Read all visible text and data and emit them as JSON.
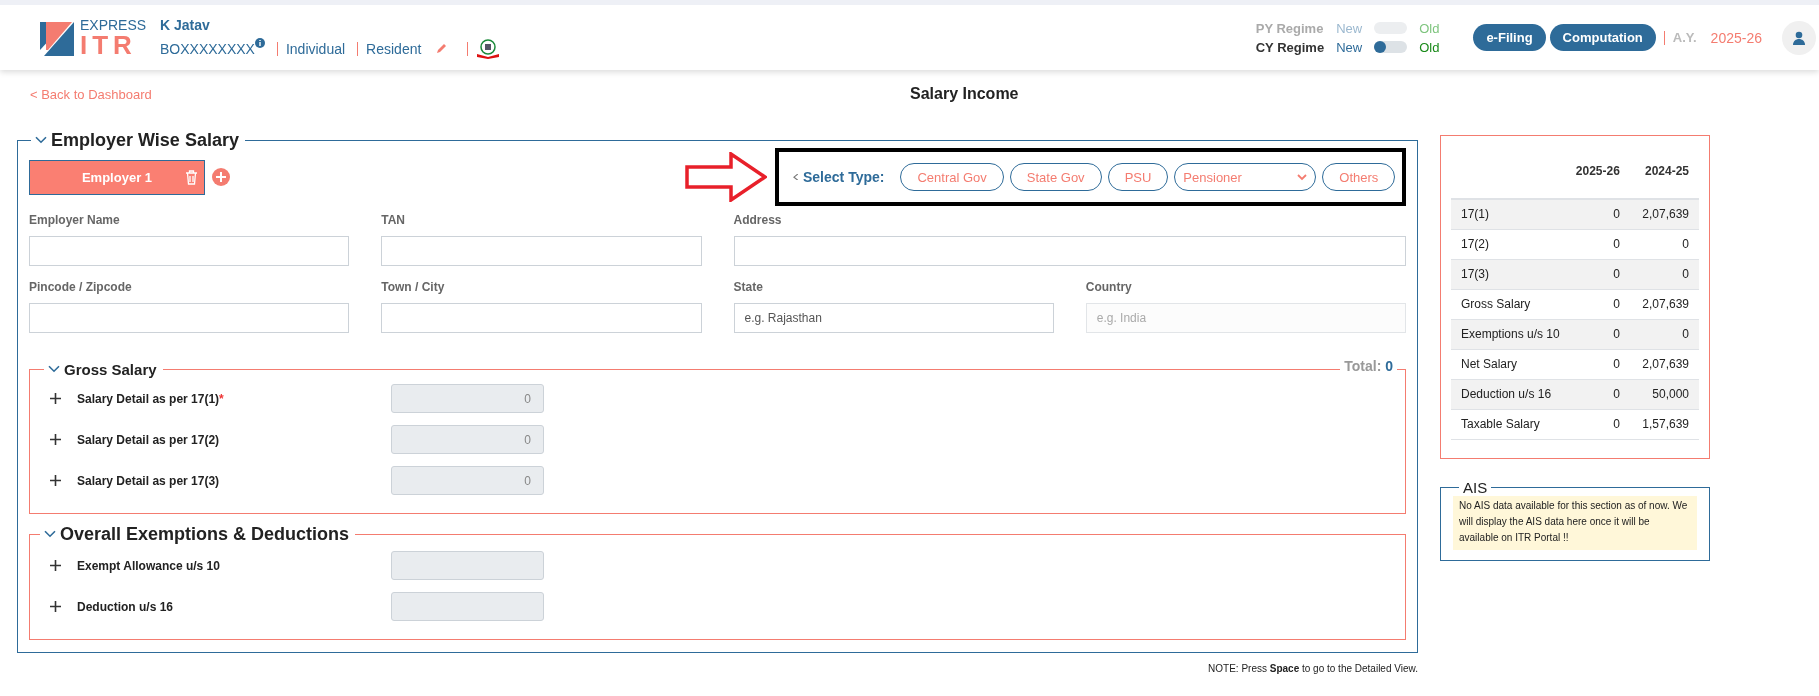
{
  "header": {
    "logo": {
      "top": "EXPRESS",
      "bottom": "ITR"
    },
    "user_name": "K Jatav",
    "pan": "BOXXXXXXXX",
    "status": [
      "Individual",
      "Resident"
    ],
    "regimes": [
      {
        "label": "PY Regime",
        "new_label": "New",
        "old_label": "Old",
        "disabled": true
      },
      {
        "label": "CY Regime",
        "new_label": "New",
        "old_label": "Old",
        "disabled": false,
        "old": false
      }
    ],
    "buttons": [
      "e-Filing",
      "Computation"
    ],
    "ay_label": "A.Y.",
    "ay_value": "2025-26"
  },
  "back_link": "< Back to Dashboard",
  "page_title": "Salary Income",
  "employer_section": {
    "title": "Employer Wise Salary",
    "employers": [
      {
        "label": "Employer 1",
        "selected": true
      }
    ],
    "select_type": {
      "label": "Select Type:",
      "options": [
        {
          "kind": "button",
          "label": "Central Gov"
        },
        {
          "kind": "button",
          "label": "State Gov"
        },
        {
          "kind": "button",
          "label": "PSU"
        },
        {
          "kind": "dropdown",
          "label": "Pensioner"
        },
        {
          "kind": "button",
          "label": "Others"
        }
      ]
    },
    "field_rows": [
      [
        {
          "label": "Employer Name",
          "disabled": false
        },
        {
          "label": "TAN",
          "disabled": false
        },
        {
          "label": "Address",
          "disabled": false
        }
      ],
      [
        {
          "label": "Pincode / Zipcode",
          "disabled": false
        },
        {
          "label": "Town / City",
          "disabled": false
        },
        {
          "label": "State",
          "placeholder": "e.g. Rajasthan",
          "disabled": false
        },
        {
          "label": "Country",
          "placeholder": "e.g. India",
          "disabled": true
        }
      ]
    ]
  },
  "gross_salary": {
    "title": "Gross Salary",
    "total_label": "Total:",
    "total": "0",
    "rows": [
      {
        "label": "Salary Detail as per 17(1)",
        "required_mark": "*",
        "value": "0"
      },
      {
        "label": "Salary Detail as per 17(2)",
        "value": "0"
      },
      {
        "label": "Salary Detail as per 17(3)",
        "value": "0"
      }
    ]
  },
  "exemptions": {
    "title": "Overall Exemptions & Deductions",
    "rows": [
      {
        "label": "Exempt Allowance u/s 10"
      },
      {
        "label": "Deduction u/s 16"
      }
    ]
  },
  "summary": {
    "columns": [
      "2025-26",
      "2024-25"
    ],
    "rows": [
      {
        "label": "17(1)",
        "values": [
          "0",
          "2,07,639"
        ]
      },
      {
        "label": "17(2)",
        "values": [
          "0",
          "0"
        ]
      },
      {
        "label": "17(3)",
        "values": [
          "0",
          "0"
        ]
      },
      {
        "label": "Gross Salary",
        "values": [
          "0",
          "2,07,639"
        ]
      },
      {
        "label": "Exemptions u/s 10",
        "values": [
          "0",
          "0"
        ]
      },
      {
        "label": "Net Salary",
        "values": [
          "0",
          "2,07,639"
        ]
      },
      {
        "label": "Deduction u/s 16",
        "values": [
          "0",
          "50,000"
        ]
      },
      {
        "label": "Taxable Salary",
        "values": [
          "0",
          "1,57,639"
        ]
      }
    ]
  },
  "ais": {
    "title": "AIS",
    "message": "No AIS data available for this section as of now. We will display the AIS data here once it will be available on ITR Portal !!"
  },
  "note": "NOTE: Press **Space** to go to the Detailed View."
}
